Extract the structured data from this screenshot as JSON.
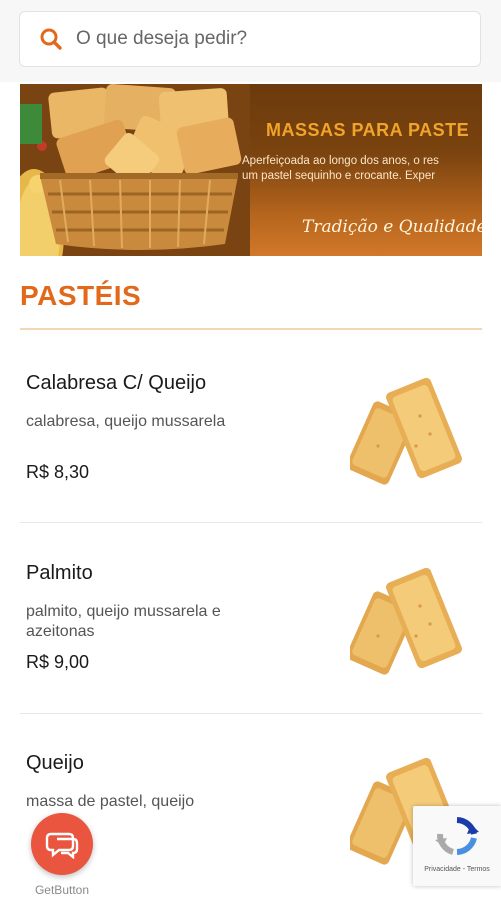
{
  "search": {
    "placeholder": "O que deseja pedir?",
    "icon": "search-icon",
    "accent": "#e2691a"
  },
  "banner": {
    "title": "MASSAS PARA PASTE",
    "subtitle_line1": "Aperfeiçoada ao longo dos anos, o res",
    "subtitle_line2": "um pastel sequinho e crocante. Exper",
    "tagline": "Tradição e Qualidade!"
  },
  "section": {
    "title": "PASTÉIS",
    "color": "#e2691a"
  },
  "products": [
    {
      "name": "Calabresa C/ Queijo",
      "description": "calabresa, queijo mussarela",
      "price": "R$ 8,30"
    },
    {
      "name": "Palmito",
      "description": "palmito, queijo mussarela e azeitonas",
      "price": "R$ 9,00"
    },
    {
      "name": "Queijo",
      "description": "massa de pastel, queijo",
      "price": ""
    }
  ],
  "floating": {
    "chat_label": "GetButton",
    "chat_color": "#e9553e",
    "recaptcha_text": "Privacidade - Termos"
  }
}
